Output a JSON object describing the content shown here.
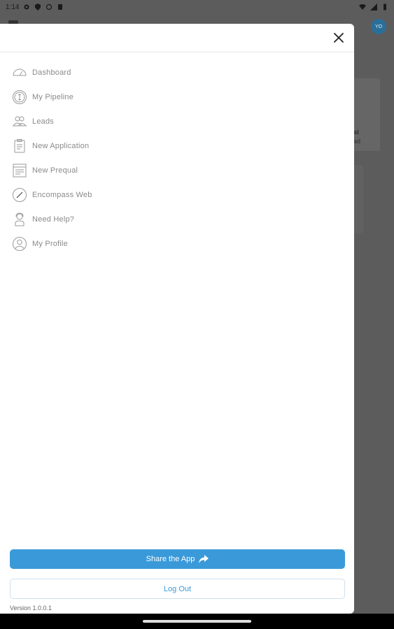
{
  "status_bar": {
    "time": "1:14"
  },
  "background": {
    "avatar_initials": "YO",
    "card_title": "at",
    "card_sub": "ad"
  },
  "menu": {
    "items": [
      {
        "label": "Dashboard",
        "icon": "dashboard-gauge-icon"
      },
      {
        "label": "My Pipeline",
        "icon": "pipeline-dollar-icon"
      },
      {
        "label": "Leads",
        "icon": "leads-people-icon"
      },
      {
        "label": "New Application",
        "icon": "application-clipboard-icon"
      },
      {
        "label": "New Prequal",
        "icon": "prequal-form-icon"
      },
      {
        "label": "Encompass Web",
        "icon": "compass-icon"
      },
      {
        "label": "Need Help?",
        "icon": "help-agent-icon"
      },
      {
        "label": "My Profile",
        "icon": "profile-user-icon"
      }
    ]
  },
  "actions": {
    "share_label": "Share the App",
    "logout_label": "Log Out"
  },
  "footer": {
    "version": "Version 1.0.0.1"
  },
  "colors": {
    "accent": "#3a9ad9",
    "icon_gray": "#9a9a9a",
    "label_gray": "#8a8a8a"
  }
}
